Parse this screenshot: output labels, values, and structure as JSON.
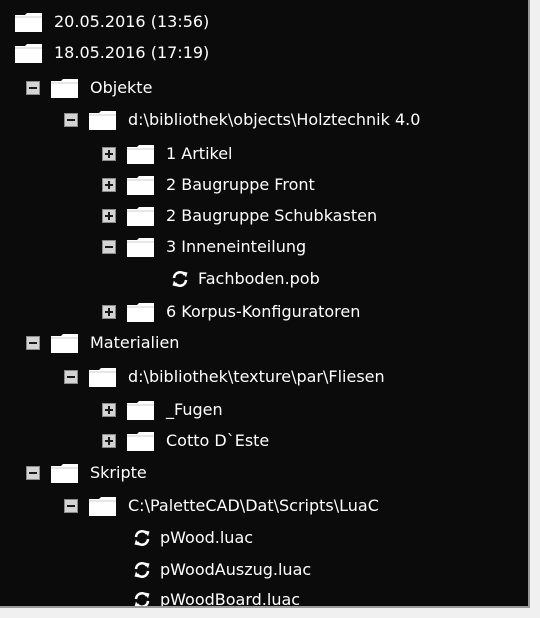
{
  "tree": {
    "rows": [
      {
        "label": "20.05.2016 (13:56)",
        "type": "folder",
        "toggle": "none"
      },
      {
        "label": "18.05.2016 (17:19)",
        "type": "folder",
        "toggle": "none"
      },
      {
        "label": "Objekte",
        "type": "folder",
        "toggle": "minus"
      },
      {
        "label": "d:\\bibliothek\\objects\\Holztechnik 4.0",
        "type": "folder",
        "toggle": "minus"
      },
      {
        "label": "1 Artikel",
        "type": "folder",
        "toggle": "plus"
      },
      {
        "label": "2 Baugruppe Front",
        "type": "folder",
        "toggle": "plus"
      },
      {
        "label": "2 Baugruppe Schubkasten",
        "type": "folder",
        "toggle": "plus"
      },
      {
        "label": "3 Inneneinteilung",
        "type": "folder",
        "toggle": "minus"
      },
      {
        "label": "Fachboden.pob",
        "type": "file",
        "icon": "refresh-icon"
      },
      {
        "label": "6 Korpus-Konfiguratoren",
        "type": "folder",
        "toggle": "plus"
      },
      {
        "label": "Materialien",
        "type": "folder",
        "toggle": "minus"
      },
      {
        "label": "d:\\bibliothek\\texture\\par\\Fliesen",
        "type": "folder",
        "toggle": "minus"
      },
      {
        "label": "_Fugen",
        "type": "folder",
        "toggle": "plus"
      },
      {
        "label": "Cotto D`Este",
        "type": "folder",
        "toggle": "plus"
      },
      {
        "label": "Skripte",
        "type": "folder",
        "toggle": "minus"
      },
      {
        "label": "C:\\PaletteCAD\\Dat\\Scripts\\LuaC",
        "type": "folder",
        "toggle": "minus"
      },
      {
        "label": "pWood.luac",
        "type": "file",
        "icon": "refresh-icon"
      },
      {
        "label": "pWoodAuszug.luac",
        "type": "file",
        "icon": "refresh-icon"
      },
      {
        "label": "pWoodBoard.luac",
        "type": "file",
        "icon": "refresh-icon"
      }
    ]
  },
  "colors": {
    "background": "#0b0b0b",
    "text": "#ffffff",
    "folder": "#ffffff",
    "toggle_box": "#d4d4d4"
  }
}
